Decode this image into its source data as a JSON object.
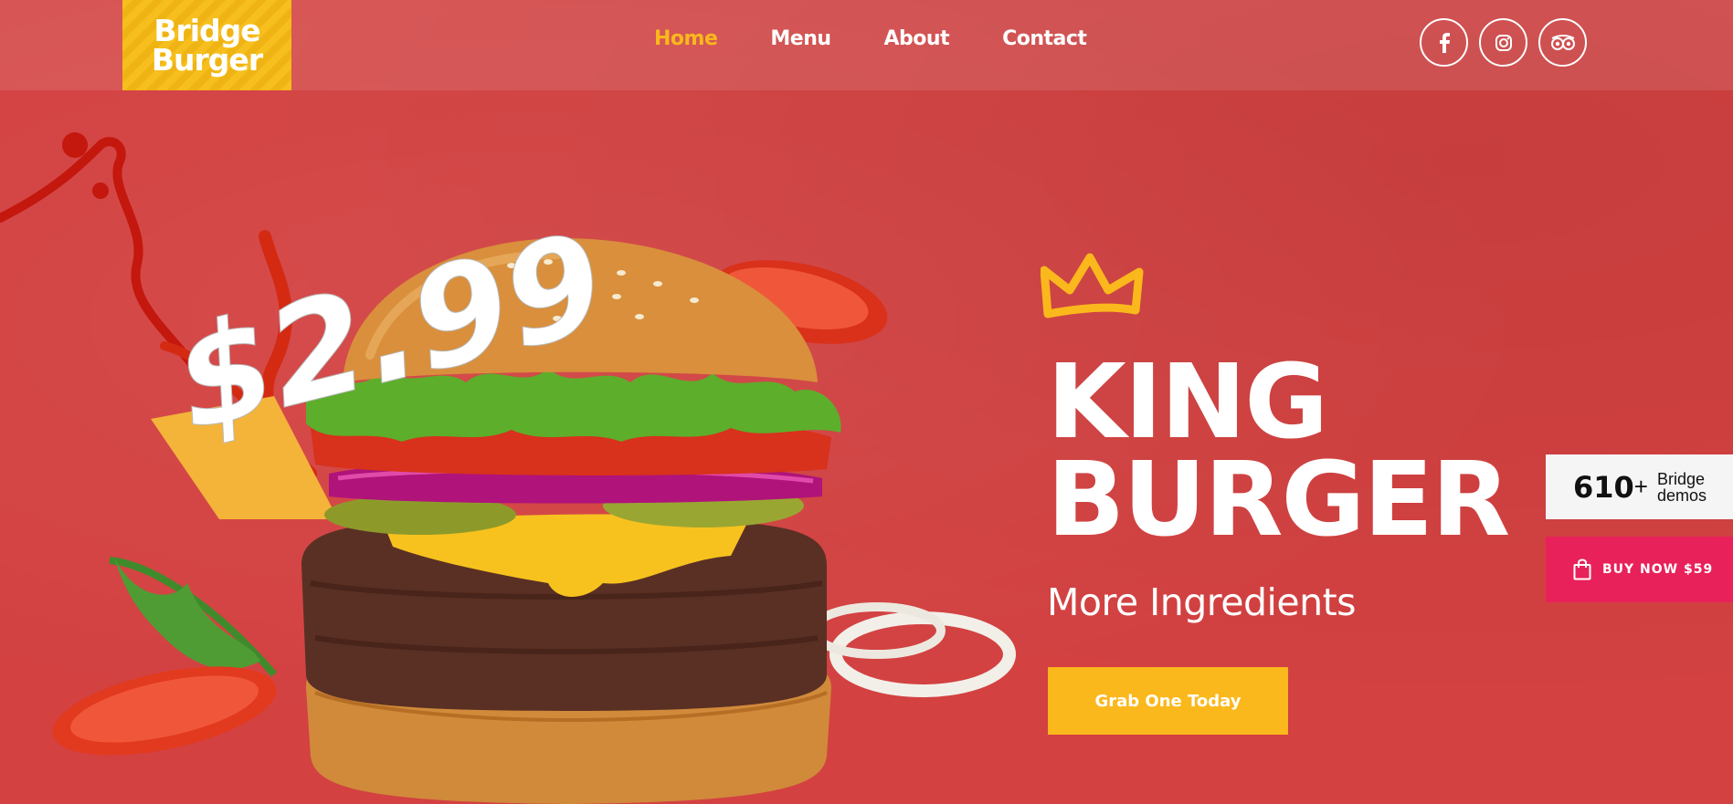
{
  "brand": {
    "logo_line1": "Bridge",
    "logo_line2": "Burger"
  },
  "nav": {
    "items": [
      {
        "label": "Home",
        "active": true
      },
      {
        "label": "Menu",
        "active": false
      },
      {
        "label": "About",
        "active": false
      },
      {
        "label": "Contact",
        "active": false
      }
    ]
  },
  "social": [
    "facebook-icon",
    "instagram-icon",
    "tripadvisor-icon"
  ],
  "hero": {
    "price": "$2.99",
    "title_line1": "KING",
    "title_line2": "BURGER",
    "subtitle": "More Ingredients",
    "cta_label": "Grab One Today"
  },
  "side_widgets": {
    "demos_count": "610",
    "demos_plus": "+",
    "demos_label_line1": "Bridge",
    "demos_label_line2": "demos",
    "buy_label": "BUY NOW $59"
  },
  "colors": {
    "background": "#d34141",
    "accent_yellow": "#fbb81c",
    "buy_pink": "#e8215a",
    "text_white": "#ffffff"
  }
}
